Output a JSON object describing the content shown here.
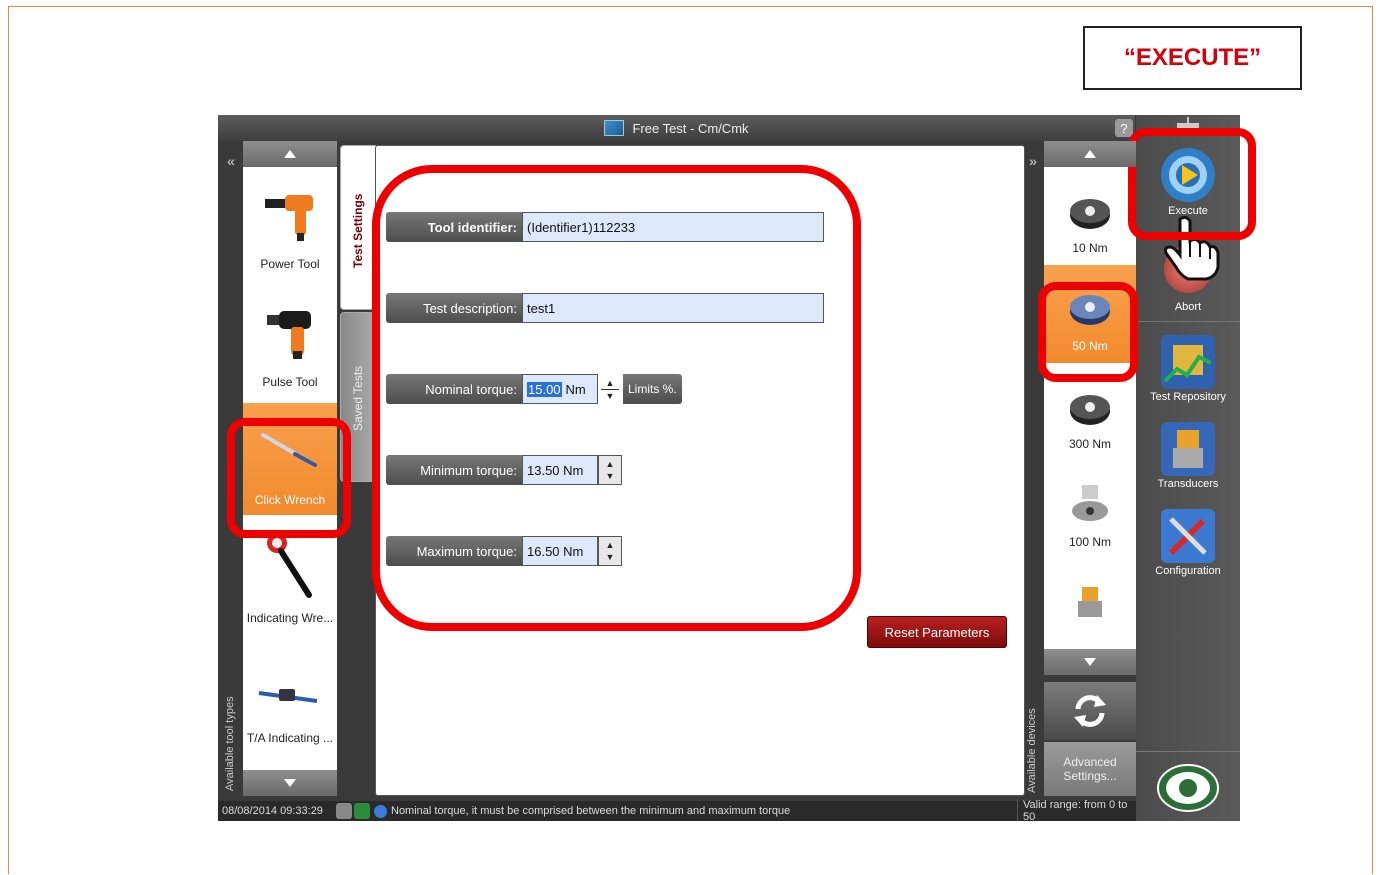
{
  "callout": {
    "text": "“EXECUTE”"
  },
  "window": {
    "title": "Free Test - Cm/Cmk",
    "help": "?"
  },
  "left_panel": {
    "collapse": "«",
    "caption": "Available tool types",
    "tools": [
      {
        "label": "Power Tool"
      },
      {
        "label": "Pulse Tool"
      },
      {
        "label": "Click Wrench"
      },
      {
        "label": "Indicating Wre..."
      },
      {
        "label": "T/A Indicating ..."
      }
    ]
  },
  "tabs": {
    "test_settings": "Test Settings",
    "saved_tests": "Saved Tests"
  },
  "form": {
    "tool_identifier_label": "Tool identifier:",
    "tool_identifier_value": "(Identifier1)112233",
    "test_description_label": "Test description:",
    "test_description_value": "test1",
    "nominal_torque_label": "Nominal torque:",
    "nominal_torque_value": "15.00",
    "nominal_torque_unit": "Nm",
    "limits_label": "Limits %.",
    "minimum_torque_label": "Minimum torque:",
    "minimum_torque_value": "13.50 Nm",
    "maximum_torque_label": "Maximum torque:",
    "maximum_torque_value": "16.50 Nm",
    "reset_label": "Reset Parameters"
  },
  "right_panel": {
    "collapse": "»",
    "caption": "Available devices",
    "devices": [
      {
        "label": "10 Nm"
      },
      {
        "label": "50 Nm"
      },
      {
        "label": "300 Nm"
      },
      {
        "label": "100 Nm"
      }
    ],
    "advanced": "Advanced Settings..."
  },
  "sidebar": {
    "items": [
      {
        "label": "Execute"
      },
      {
        "label": "Abort"
      },
      {
        "label": "Test Repository"
      },
      {
        "label": "Transducers"
      },
      {
        "label": "Configuration"
      }
    ]
  },
  "status": {
    "datetime": "08/08/2014 09:33:29",
    "message": "Nominal torque, it must be comprised between the minimum and maximum torque",
    "range": "Valid range: from 0 to 50"
  },
  "colors": {
    "accent": "#f28a2d",
    "annotation": "#e00000",
    "reset": "#8a1010"
  }
}
